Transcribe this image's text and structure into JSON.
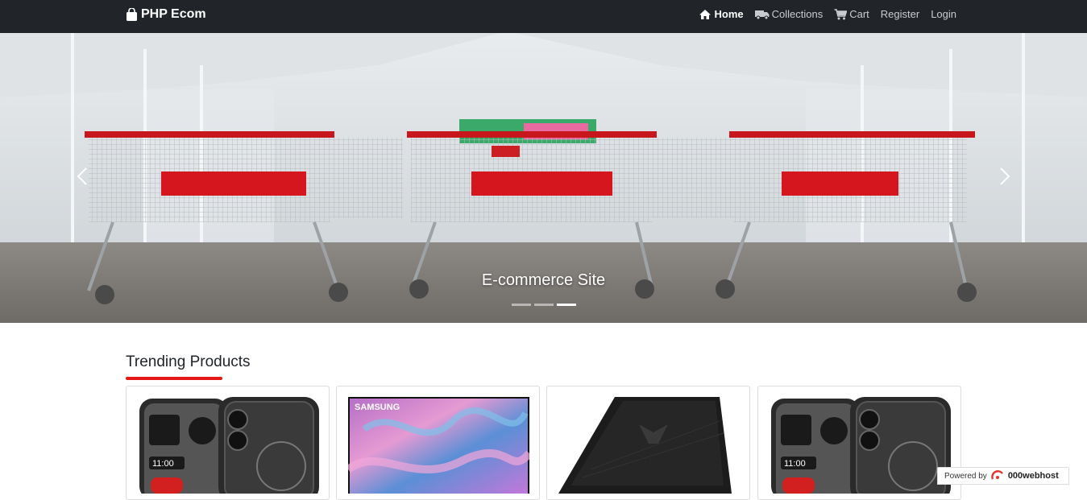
{
  "navbar": {
    "brand": "PHP Ecom",
    "links": [
      {
        "label": "Home",
        "icon": "home-icon",
        "active": true
      },
      {
        "label": "Collections",
        "icon": "truck-icon",
        "active": false
      },
      {
        "label": "Cart",
        "icon": "cart-icon",
        "active": false
      },
      {
        "label": "Register",
        "icon": "",
        "active": false
      },
      {
        "label": "Login",
        "icon": "",
        "active": false
      }
    ]
  },
  "hero": {
    "caption": "E-commerce Site",
    "indicator_count": 3,
    "active_indicator": 3
  },
  "trending": {
    "title": "Trending Products",
    "products": [
      {
        "image": "phone-image",
        "screen_text": "11:00"
      },
      {
        "image": "tv-image",
        "brand_text": "SAMSUNG"
      },
      {
        "image": "laptop-image"
      },
      {
        "image": "phone-image",
        "screen_text": "11:00"
      }
    ]
  },
  "footer_badge": {
    "prefix": "Powered by",
    "name": "000webhost"
  },
  "colors": {
    "navbar_bg": "#212529",
    "accent_red": "#e51818"
  }
}
